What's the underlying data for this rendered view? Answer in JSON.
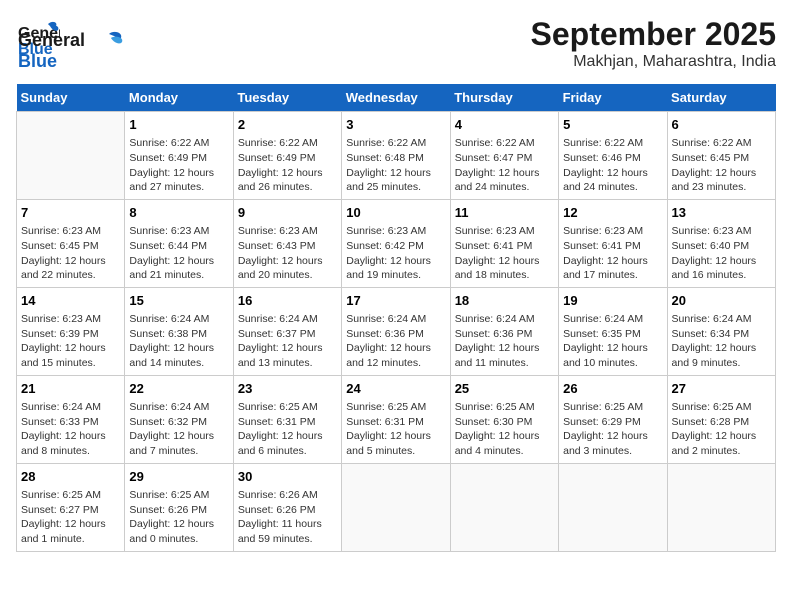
{
  "header": {
    "logo_line1": "General",
    "logo_line2": "Blue",
    "main_title": "September 2025",
    "sub_title": "Makhjan, Maharashtra, India"
  },
  "calendar": {
    "days_of_week": [
      "Sunday",
      "Monday",
      "Tuesday",
      "Wednesday",
      "Thursday",
      "Friday",
      "Saturday"
    ],
    "weeks": [
      [
        {
          "day": "",
          "info": ""
        },
        {
          "day": "1",
          "info": "Sunrise: 6:22 AM\nSunset: 6:49 PM\nDaylight: 12 hours\nand 27 minutes."
        },
        {
          "day": "2",
          "info": "Sunrise: 6:22 AM\nSunset: 6:49 PM\nDaylight: 12 hours\nand 26 minutes."
        },
        {
          "day": "3",
          "info": "Sunrise: 6:22 AM\nSunset: 6:48 PM\nDaylight: 12 hours\nand 25 minutes."
        },
        {
          "day": "4",
          "info": "Sunrise: 6:22 AM\nSunset: 6:47 PM\nDaylight: 12 hours\nand 24 minutes."
        },
        {
          "day": "5",
          "info": "Sunrise: 6:22 AM\nSunset: 6:46 PM\nDaylight: 12 hours\nand 24 minutes."
        },
        {
          "day": "6",
          "info": "Sunrise: 6:22 AM\nSunset: 6:45 PM\nDaylight: 12 hours\nand 23 minutes."
        }
      ],
      [
        {
          "day": "7",
          "info": "Sunrise: 6:23 AM\nSunset: 6:45 PM\nDaylight: 12 hours\nand 22 minutes."
        },
        {
          "day": "8",
          "info": "Sunrise: 6:23 AM\nSunset: 6:44 PM\nDaylight: 12 hours\nand 21 minutes."
        },
        {
          "day": "9",
          "info": "Sunrise: 6:23 AM\nSunset: 6:43 PM\nDaylight: 12 hours\nand 20 minutes."
        },
        {
          "day": "10",
          "info": "Sunrise: 6:23 AM\nSunset: 6:42 PM\nDaylight: 12 hours\nand 19 minutes."
        },
        {
          "day": "11",
          "info": "Sunrise: 6:23 AM\nSunset: 6:41 PM\nDaylight: 12 hours\nand 18 minutes."
        },
        {
          "day": "12",
          "info": "Sunrise: 6:23 AM\nSunset: 6:41 PM\nDaylight: 12 hours\nand 17 minutes."
        },
        {
          "day": "13",
          "info": "Sunrise: 6:23 AM\nSunset: 6:40 PM\nDaylight: 12 hours\nand 16 minutes."
        }
      ],
      [
        {
          "day": "14",
          "info": "Sunrise: 6:23 AM\nSunset: 6:39 PM\nDaylight: 12 hours\nand 15 minutes."
        },
        {
          "day": "15",
          "info": "Sunrise: 6:24 AM\nSunset: 6:38 PM\nDaylight: 12 hours\nand 14 minutes."
        },
        {
          "day": "16",
          "info": "Sunrise: 6:24 AM\nSunset: 6:37 PM\nDaylight: 12 hours\nand 13 minutes."
        },
        {
          "day": "17",
          "info": "Sunrise: 6:24 AM\nSunset: 6:36 PM\nDaylight: 12 hours\nand 12 minutes."
        },
        {
          "day": "18",
          "info": "Sunrise: 6:24 AM\nSunset: 6:36 PM\nDaylight: 12 hours\nand 11 minutes."
        },
        {
          "day": "19",
          "info": "Sunrise: 6:24 AM\nSunset: 6:35 PM\nDaylight: 12 hours\nand 10 minutes."
        },
        {
          "day": "20",
          "info": "Sunrise: 6:24 AM\nSunset: 6:34 PM\nDaylight: 12 hours\nand 9 minutes."
        }
      ],
      [
        {
          "day": "21",
          "info": "Sunrise: 6:24 AM\nSunset: 6:33 PM\nDaylight: 12 hours\nand 8 minutes."
        },
        {
          "day": "22",
          "info": "Sunrise: 6:24 AM\nSunset: 6:32 PM\nDaylight: 12 hours\nand 7 minutes."
        },
        {
          "day": "23",
          "info": "Sunrise: 6:25 AM\nSunset: 6:31 PM\nDaylight: 12 hours\nand 6 minutes."
        },
        {
          "day": "24",
          "info": "Sunrise: 6:25 AM\nSunset: 6:31 PM\nDaylight: 12 hours\nand 5 minutes."
        },
        {
          "day": "25",
          "info": "Sunrise: 6:25 AM\nSunset: 6:30 PM\nDaylight: 12 hours\nand 4 minutes."
        },
        {
          "day": "26",
          "info": "Sunrise: 6:25 AM\nSunset: 6:29 PM\nDaylight: 12 hours\nand 3 minutes."
        },
        {
          "day": "27",
          "info": "Sunrise: 6:25 AM\nSunset: 6:28 PM\nDaylight: 12 hours\nand 2 minutes."
        }
      ],
      [
        {
          "day": "28",
          "info": "Sunrise: 6:25 AM\nSunset: 6:27 PM\nDaylight: 12 hours\nand 1 minute."
        },
        {
          "day": "29",
          "info": "Sunrise: 6:25 AM\nSunset: 6:26 PM\nDaylight: 12 hours\nand 0 minutes."
        },
        {
          "day": "30",
          "info": "Sunrise: 6:26 AM\nSunset: 6:26 PM\nDaylight: 11 hours\nand 59 minutes."
        },
        {
          "day": "",
          "info": ""
        },
        {
          "day": "",
          "info": ""
        },
        {
          "day": "",
          "info": ""
        },
        {
          "day": "",
          "info": ""
        }
      ]
    ]
  }
}
